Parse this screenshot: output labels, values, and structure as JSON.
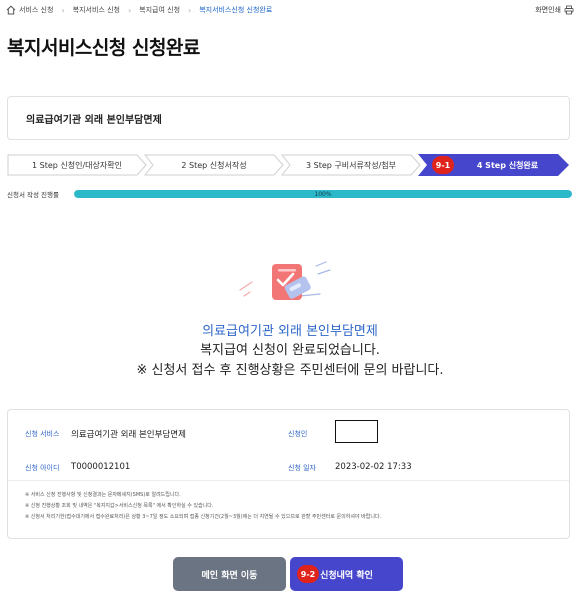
{
  "breadcrumb": {
    "items": [
      "서비스 신청",
      "복지서비스 신청",
      "복지급여 신청",
      "복지서비스신청 신청완료"
    ]
  },
  "header": {
    "print_label": "화면인쇄"
  },
  "page_title": "복지서비스신청 신청완료",
  "service_name": "의료급여기관 외래 본인부담면제",
  "steps": [
    {
      "label": "1 Step 신청인/대상자확인"
    },
    {
      "label": "2 Step 신청서작성"
    },
    {
      "label": "3 Step 구비서류작성/첨부"
    },
    {
      "label": "4 Step 신청완료"
    }
  ],
  "annotations": {
    "step_badge": "9-1",
    "button_badge": "9-2"
  },
  "progress": {
    "label": "신청서 작성 진행률",
    "text": "100%",
    "value": 1.0
  },
  "completion": {
    "service": "의료급여기관 외래 본인부담면제",
    "message": "복지급여 신청이 완료되었습니다.",
    "notice": "※ 신청서 접수 후 진행상황은 주민센터에 문의 바랍니다."
  },
  "details": {
    "service_label": "신청 서비스",
    "service_value": "의료급여기관 외래 본인부담면제",
    "applicant_label": "신청인",
    "applicant_value": "",
    "id_label": "신청 아이디",
    "id_value": "T0000012101",
    "date_label": "신청 일자",
    "date_value": "2023-02-02 17:33"
  },
  "notes": [
    "※ 서비스 신청 진행사항 및 신청결과는 문자메세지(SMS)로 알려드립니다.",
    "※ 신청 진행상황 조회 및 내역은 \"복지지갑>서비스신청 목록\" 에서 확인하실 수 있습니다.",
    "※ 신청서 처리기한(접수대기에서 접수완료처리)은 상황 3~7일 정도 소요되며 접종 신청기간(2월~3월)에는 더 지연될 수 있으므로 관할 주민센터로 문의하셔야 바랍니다."
  ],
  "buttons": {
    "main": "메인 화면 이동",
    "check": "신청내역 확인"
  },
  "colors": {
    "accent": "#4646cc",
    "progress": "#2bb9c9",
    "badge": "#e0231b",
    "link": "#2f66c9"
  }
}
